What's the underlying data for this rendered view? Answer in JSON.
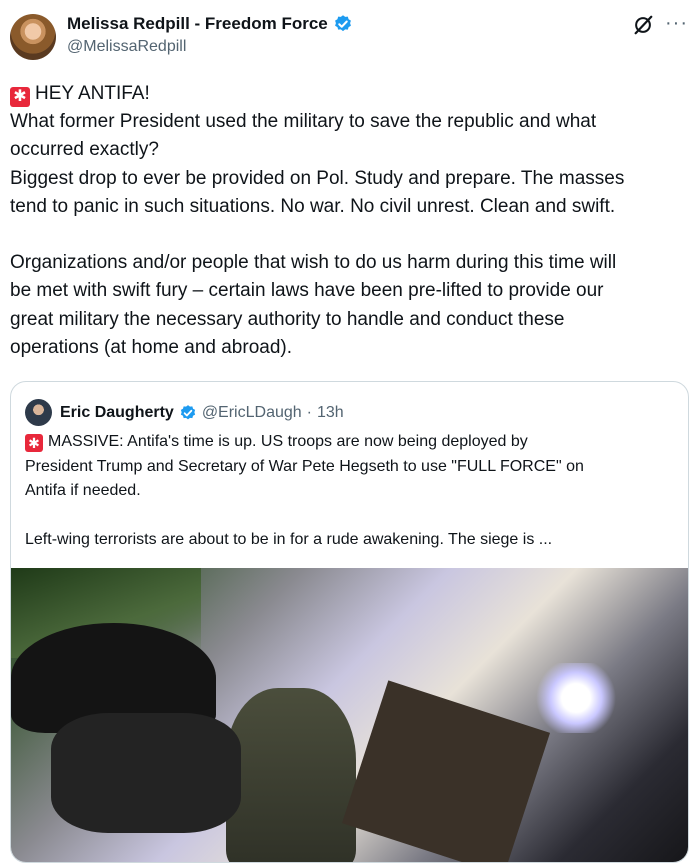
{
  "post": {
    "display_name": "Melissa Redpill - Freedom Force",
    "handle": "@MelissaRedpill",
    "verified_color": "#1d9bf0",
    "lines": [
      "HEY ANTIFA!",
      "What former President used the military to save the republic and what",
      "occurred exactly?",
      "Biggest drop to ever be provided on Pol. Study and prepare. The masses",
      "tend to panic in such situations. No war. No civil unrest. Clean and swift.",
      "",
      "Organizations and/or people that wish to do us harm during this time will",
      "be met with swift fury – certain laws have been pre-lifted to provide our",
      "great military the necessary authority to handle and conduct these",
      "operations (at home and abroad)."
    ],
    "siren_glyph": "✱"
  },
  "quote": {
    "display_name": "Eric Daugherty",
    "handle": "@EricLDaugh",
    "separator": "·",
    "time": "13h",
    "lines": [
      "MASSIVE: Antifa's time is up. US troops are now being deployed by",
      "President Trump and Secretary of War Pete Hegseth to use \"FULL FORCE\" on",
      "Antifa if needed.",
      "",
      "Left-wing terrorists are about to be in for a rude awakening. The siege is ..."
    ]
  },
  "icons": {
    "grok": "grok-icon",
    "more": "more-icon",
    "siren": "rotating-light-icon",
    "verified": "verified-badge-icon"
  }
}
